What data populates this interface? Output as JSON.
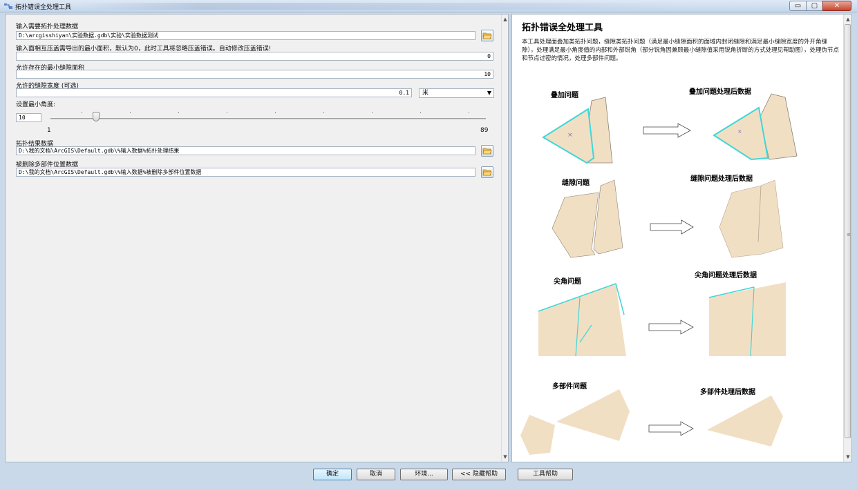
{
  "window": {
    "title": "拓扑错误全处理工具",
    "buttons": {
      "minimize": "▭",
      "maximize": "▢",
      "close": "✕"
    }
  },
  "form": {
    "input_data": {
      "label": "输入需要拓扑处理数据",
      "value": "D:\\arcgisshiyan\\实验数据.gdb\\实验\\实验数据测试"
    },
    "min_area": {
      "label": "输入面相互压盖需导出的最小面积，默认为0，此时工具将忽略压盖错误。自动修改压盖错误!",
      "value": "0"
    },
    "gap_area": {
      "label": "允许存在的最小缝隙面积",
      "value": "10"
    },
    "gap_width": {
      "label": "允许的缝隙宽度 (可选)",
      "value": "0.1",
      "unit": "米"
    },
    "min_angle": {
      "label": "设置最小角度:",
      "value": "10",
      "min_label": "1",
      "max_label": "89",
      "slider_level": 10
    },
    "output_data": {
      "label": "拓扑结果数据",
      "value": "D:\\我的文档\\ArcGIS\\Default.gdb\\%输入数据%拓扑处理结果"
    },
    "removed_parts": {
      "label": "被删除多部件位置数据",
      "value": "D:\\我的文档\\ArcGIS\\Default.gdb\\%输入数据%被删除多部件位置数据"
    }
  },
  "help": {
    "title": "拓扑错误全处理工具",
    "body": "本工具处理面叠加类拓扑问题，缝隙类拓扑问题（满足最小缝隙面积的面域内封闭缝隙和满足最小缝隙宽度的外开角缝隙），处理满足最小角度值的内部和外部锐角（部分锐角因兼顾最小缝隙值采用锐角折断的方式处理见帮助图），处理伪节点和节点过密的情况，处理多部件问题。",
    "figures": [
      {
        "before": "叠加问题",
        "after": "叠加问题处理后数据"
      },
      {
        "before": "缝隙问题",
        "after": "缝隙问题处理后数据"
      },
      {
        "before": "尖角问题",
        "after": "尖角问题处理后数据"
      },
      {
        "before": "多部件问题",
        "after": "多部件处理后数据"
      }
    ]
  },
  "footer": {
    "ok": "确定",
    "cancel": "取消",
    "environments": "环境...",
    "hide_help": "<< 隐藏帮助",
    "tool_help": "工具帮助"
  },
  "colors": {
    "polygon_fill": "#f1dfc4",
    "highlight": "#3fd6d8",
    "polygon_stroke": "#8c7f72",
    "default_button": "#bee6fd"
  },
  "icons": [
    "app-icon",
    "folder-open-icon",
    "chevron-down-icon",
    "right-arrow-icon",
    "scroll-up-icon",
    "scroll-down-icon"
  ]
}
